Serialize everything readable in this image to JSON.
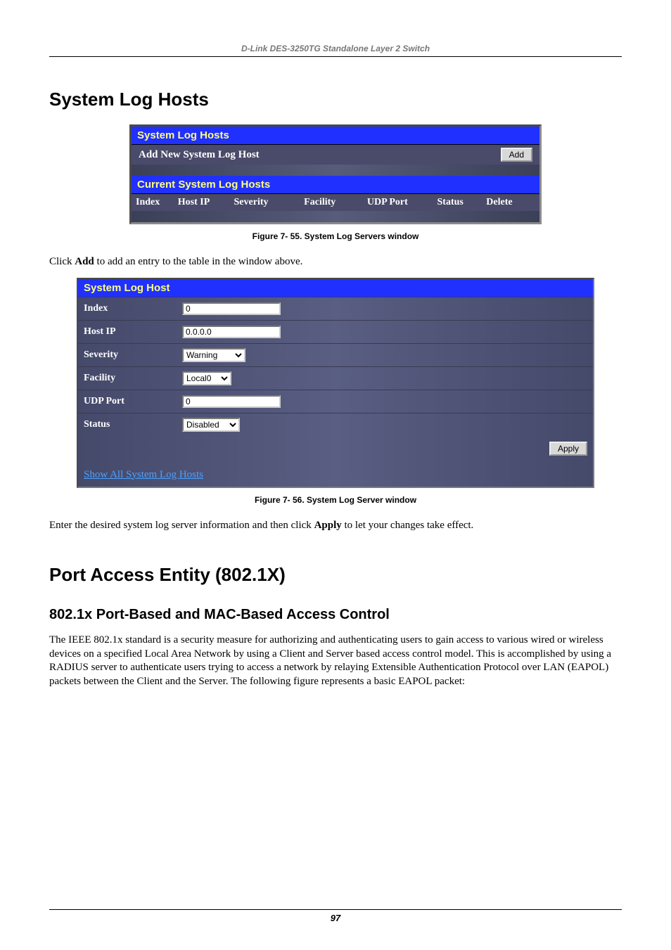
{
  "header": {
    "doc_title": "D-Link DES-3250TG Standalone Layer 2 Switch"
  },
  "section1": {
    "heading": "System Log Hosts"
  },
  "panel1": {
    "title": "System Log Hosts",
    "add_row_label": "Add New System Log Host",
    "add_button": "Add",
    "subtitle": "Current System Log Hosts",
    "cols": {
      "index": "Index",
      "host_ip": "Host IP",
      "severity": "Severity",
      "facility": "Facility",
      "udp_port": "UDP Port",
      "status": "Status",
      "delete": "Delete"
    }
  },
  "caption1": "Figure 7- 55.  System Log Servers window",
  "para1_a": "Click ",
  "para1_b": "Add",
  "para1_c": " to add an entry to the table in the window above.",
  "panel2": {
    "title": "System Log Host",
    "rows": {
      "index_label": "Index",
      "index_value": "0",
      "host_ip_label": "Host IP",
      "host_ip_value": "0.0.0.0",
      "severity_label": "Severity",
      "severity_value": "Warning",
      "facility_label": "Facility",
      "facility_value": "Local0",
      "udp_label": "UDP Port",
      "udp_value": "0",
      "status_label": "Status",
      "status_value": "Disabled"
    },
    "apply_button": "Apply",
    "link": "Show All System Log Hosts"
  },
  "caption2": "Figure 7- 56.  System Log Server window",
  "para2_a": "Enter the desired system log server information and then click ",
  "para2_b": "Apply",
  "para2_c": " to let your changes take effect.",
  "section2": {
    "heading": "Port Access Entity (802.1X)",
    "subheading": "802.1x Port-Based and MAC-Based Access Control",
    "body": "The IEEE 802.1x standard is a security measure for authorizing and authenticating users to gain access to various wired or wireless devices on a specified Local Area Network by using a Client and Server based access control model. This is accomplished by using a RADIUS server to authenticate users trying to access a network by relaying Extensible Authentication Protocol over LAN (EAPOL) packets between the Client and the Server. The following figure represents a basic EAPOL packet:"
  },
  "footer": {
    "page_number": "97"
  }
}
